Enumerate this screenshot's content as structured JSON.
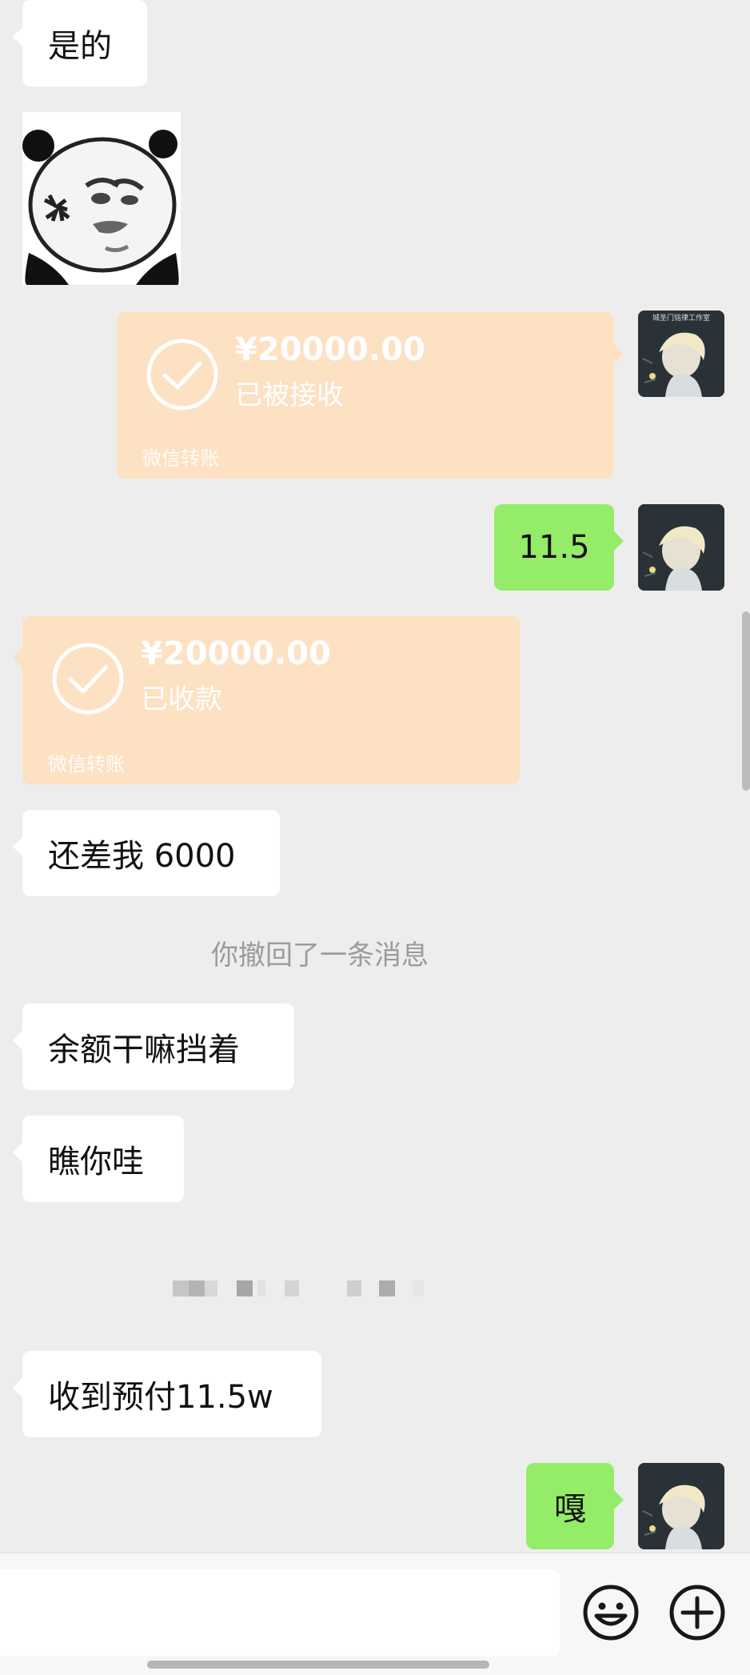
{
  "messages": {
    "m1": "是的",
    "m6": "还差我 6000",
    "m8": "余额干嘛挡着",
    "m9": "瞧你哇",
    "m11": "收到预付11.5w"
  },
  "sent": {
    "s4": "11.5",
    "s12": "嘎"
  },
  "transfers": {
    "t3": {
      "amount": "¥20000.00",
      "status": "已被接收",
      "brand": "微信转账"
    },
    "t5": {
      "amount": "¥20000.00",
      "status": "已收款",
      "brand": "微信转账"
    }
  },
  "system": {
    "recall": "你撤回了一条消息"
  },
  "avatar": {
    "caption": "城圣门铭律工作室"
  },
  "sticker": {
    "icon": "panda-meme-sticker"
  },
  "input_bar": {
    "placeholder": "",
    "emoji_icon": "emoji-icon",
    "plus_icon": "plus-icon"
  },
  "colors": {
    "background": "#ededed",
    "sent_bubble": "#95ec69",
    "received_bubble": "#ffffff",
    "transfer_card": "#fde1c3"
  }
}
